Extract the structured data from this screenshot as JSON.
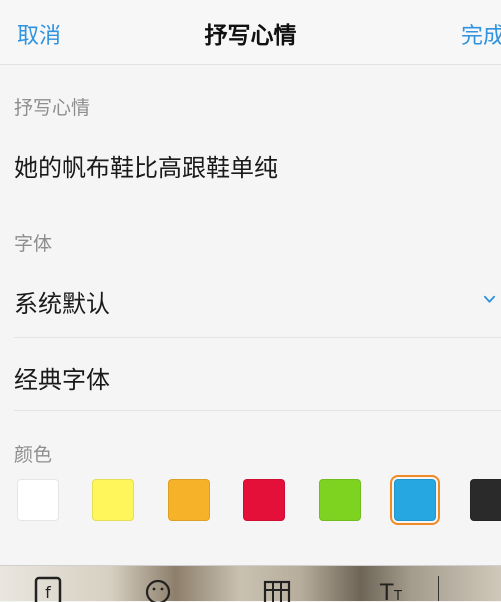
{
  "nav": {
    "cancel_label": "取消",
    "title": "抒写心情",
    "done_label": "完成",
    "accent_color": "#2f93e0"
  },
  "mood_section": {
    "label": "抒写心情",
    "text": "她的帆布鞋比高跟鞋单纯"
  },
  "font_section": {
    "label": "字体",
    "options": [
      "系统默认",
      "经典字体"
    ],
    "selected": "系统默认"
  },
  "color_section": {
    "label": "颜色",
    "swatches": [
      {
        "name": "white",
        "hex": "#ffffff"
      },
      {
        "name": "yellow",
        "hex": "#fff65c"
      },
      {
        "name": "orange",
        "hex": "#f6b329"
      },
      {
        "name": "red",
        "hex": "#e5103a"
      },
      {
        "name": "green",
        "hex": "#7ed321"
      },
      {
        "name": "blue",
        "hex": "#26a7e2"
      },
      {
        "name": "black",
        "hex": "#2a2a2a"
      }
    ],
    "selected": "blue",
    "selected_ring_color": "#f08a24"
  },
  "toolbar": {
    "icons": [
      "text-style-icon",
      "emoji-icon",
      "grid-icon",
      "text-size-icon"
    ]
  }
}
